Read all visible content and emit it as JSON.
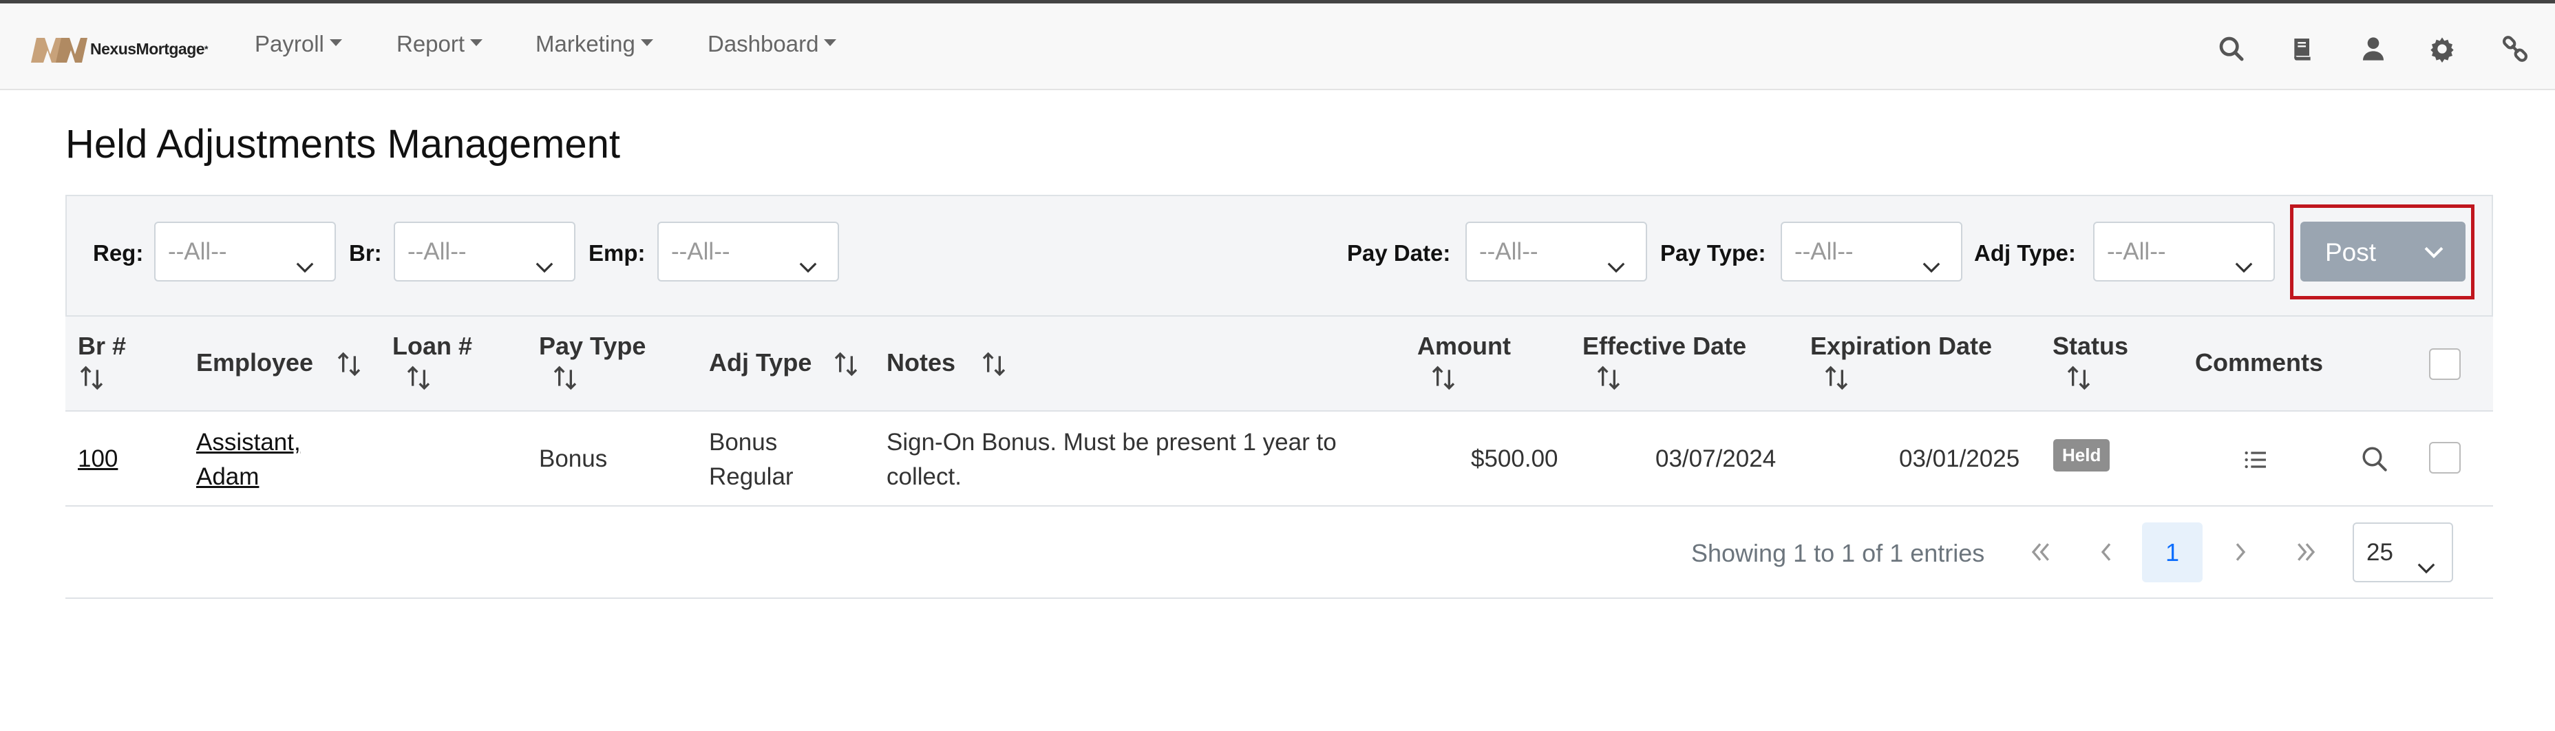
{
  "brand": {
    "name": "NexusMortgage",
    "mark_color": "#c8a27a"
  },
  "nav": {
    "menus": [
      {
        "label": "Payroll"
      },
      {
        "label": "Report"
      },
      {
        "label": "Marketing"
      },
      {
        "label": "Dashboard"
      }
    ],
    "icons": [
      "search-icon",
      "book-icon",
      "user-icon",
      "gear-icon",
      "link-icon"
    ]
  },
  "page": {
    "title": "Held Adjustments Management"
  },
  "filters": {
    "reg": {
      "label": "Reg:",
      "value": "--All--"
    },
    "br": {
      "label": "Br:",
      "value": "--All--"
    },
    "emp": {
      "label": "Emp:",
      "value": "--All--"
    },
    "pay_date": {
      "label": "Pay Date:",
      "value": "--All--"
    },
    "pay_type": {
      "label": "Pay Type:",
      "value": "--All--"
    },
    "adj_type": {
      "label": "Adj Type:",
      "value": "--All--"
    },
    "post": {
      "label": "Post"
    }
  },
  "table": {
    "columns": {
      "br": "Br #",
      "employee": "Employee",
      "loan": "Loan #",
      "pay_type": "Pay Type",
      "adj_type": "Adj Type",
      "notes": "Notes",
      "amount": "Amount",
      "effective_date": "Effective Date",
      "expiration_date": "Expiration Date",
      "status": "Status",
      "comments": "Comments"
    },
    "rows": [
      {
        "br": "100",
        "employee_line1": "Assistant,",
        "employee_line2": "Adam",
        "loan": "",
        "pay_type": "Bonus",
        "adj_type_line1": "Bonus",
        "adj_type_line2": "Regular",
        "notes_line1": "Sign-On Bonus. Must be present 1 year to",
        "notes_line2": "collect.",
        "amount": "$500.00",
        "effective_date": "03/07/2024",
        "expiration_date": "03/01/2025",
        "status": "Held"
      }
    ]
  },
  "pagination": {
    "summary": "Showing 1 to 1 of 1 entries",
    "current_page": "1",
    "page_size": "25"
  },
  "colors": {
    "post_highlight": "#c0161e",
    "post_button": "#9aa5b1",
    "status_badge": "#8e8e8e",
    "active_page": "#0d6efd"
  }
}
